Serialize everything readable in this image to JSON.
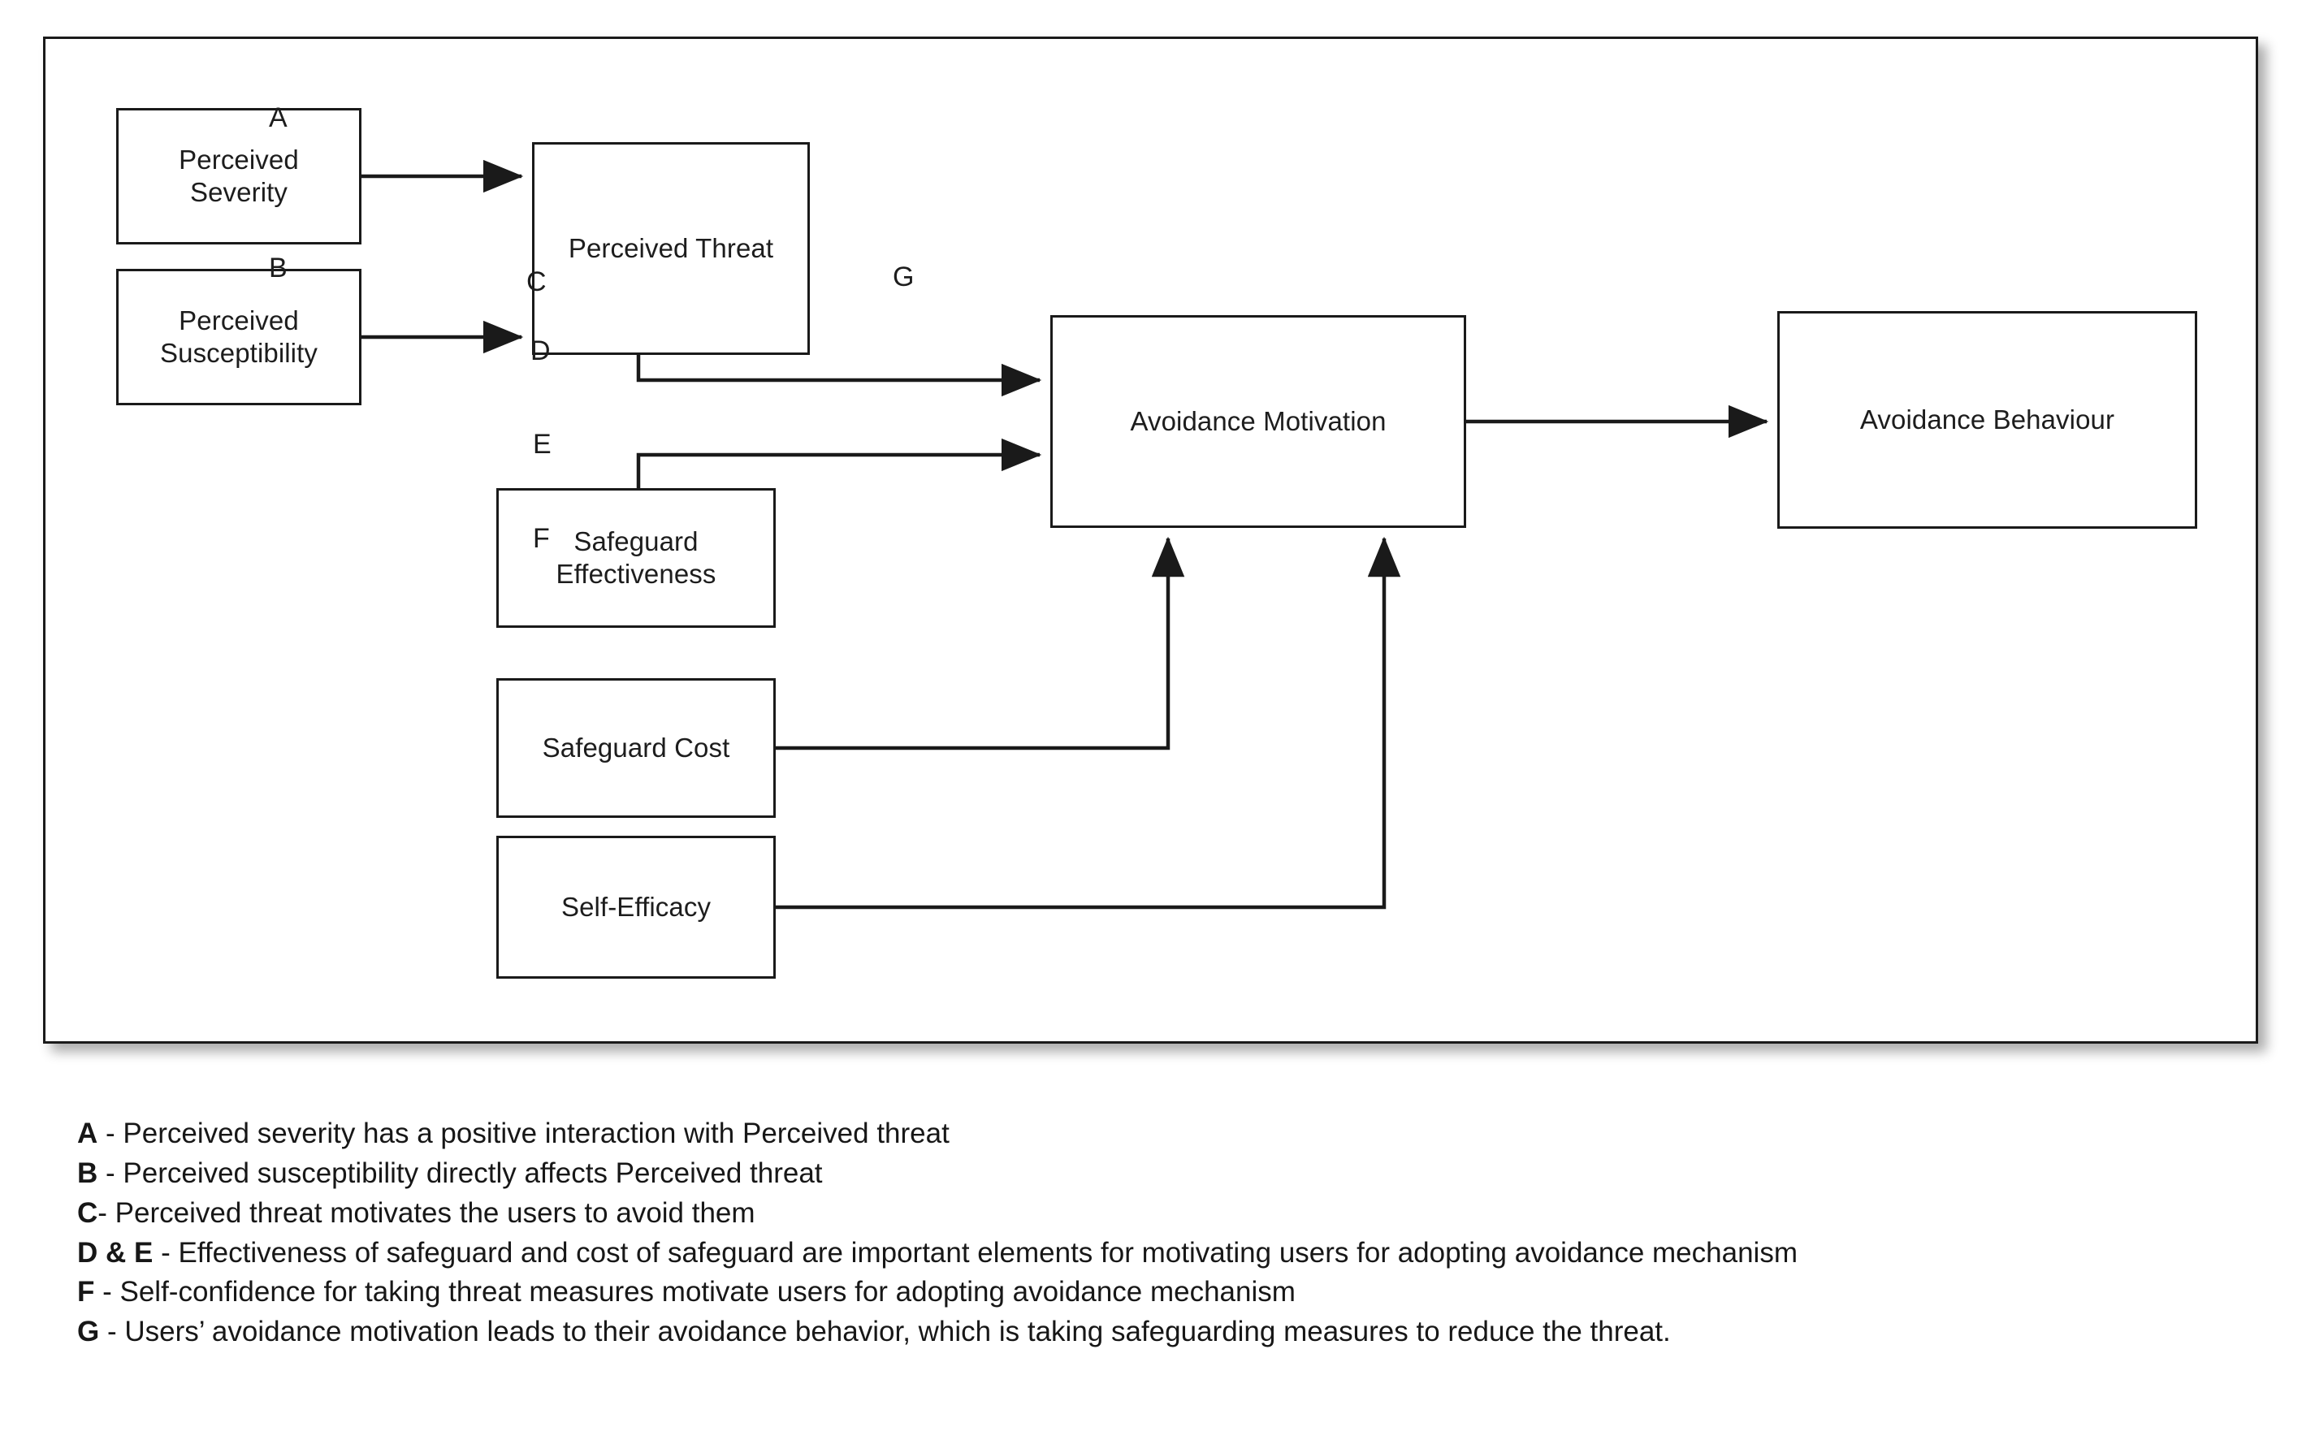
{
  "figure": {
    "nodes": [
      {
        "id": "perceived-severity",
        "label": "Perceived\nSeverity"
      },
      {
        "id": "perceived-susceptibility",
        "label": "Perceived\nSusceptibility"
      },
      {
        "id": "perceived-threat",
        "label": "Perceived Threat"
      },
      {
        "id": "avoidance-motivation",
        "label": "Avoidance Motivation"
      },
      {
        "id": "avoidance-behaviour",
        "label": "Avoidance Behaviour"
      },
      {
        "id": "safeguard-effectiveness",
        "label": "Safeguard\nEffectiveness"
      },
      {
        "id": "safeguard-cost",
        "label": "Safeguard Cost"
      },
      {
        "id": "self-efficacy",
        "label": "Self-Efficacy"
      }
    ],
    "edges": [
      {
        "id": "A",
        "label": "A",
        "from": "perceived-severity",
        "to": "perceived-threat"
      },
      {
        "id": "B",
        "label": "B",
        "from": "perceived-susceptibility",
        "to": "perceived-threat"
      },
      {
        "id": "C",
        "label": "C",
        "from": "perceived-threat",
        "to": "avoidance-motivation"
      },
      {
        "id": "D",
        "label": "D",
        "from": "safeguard-effectiveness",
        "to": "avoidance-motivation"
      },
      {
        "id": "E",
        "label": "E",
        "from": "safeguard-cost",
        "to": "avoidance-motivation"
      },
      {
        "id": "F",
        "label": "F",
        "from": "self-efficacy",
        "to": "avoidance-motivation"
      },
      {
        "id": "G",
        "label": "G",
        "from": "avoidance-motivation",
        "to": "avoidance-behaviour"
      }
    ],
    "colors": {
      "border": "#1a1a1a",
      "line": "#1a1a1a",
      "text": "#1d1d1d",
      "background": "#ffffff"
    }
  },
  "caption": {
    "lines": [
      {
        "key": "A",
        "text": " - Perceived severity has a positive interaction with Perceived threat"
      },
      {
        "key": "B",
        "text": " - Perceived susceptibility directly affects Perceived threat"
      },
      {
        "key": "C",
        "text": "- Perceived threat motivates the users to avoid them"
      },
      {
        "key": "D & E",
        "text": " - Effectiveness of safeguard and cost of safeguard are important elements for motivating users for adopting avoidance mechanism"
      },
      {
        "key": "F",
        "text": " - Self-confidence for taking threat measures motivate users for adopting avoidance mechanism"
      },
      {
        "key": "G",
        "text": " - Users’ avoidance motivation leads to their avoidance behavior, which is taking safeguarding measures to reduce the threat."
      }
    ]
  }
}
